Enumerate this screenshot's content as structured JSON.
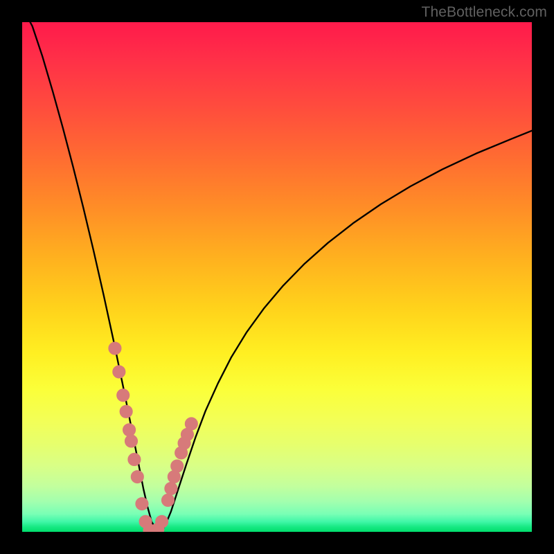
{
  "watermark": "TheBottleneck.com",
  "colors": {
    "background_frame": "#000000",
    "curve_stroke": "#000000",
    "marker_fill": "#d77a7a",
    "marker_stroke": "#d77a7a"
  },
  "chart_data": {
    "type": "line",
    "title": "",
    "xlabel": "",
    "ylabel": "",
    "xlim": [
      0,
      100
    ],
    "ylim": [
      0,
      100
    ],
    "grid": false,
    "legend": false,
    "series": [
      {
        "name": "bottleneck-curve",
        "x": [
          0,
          2,
          4,
          6,
          8,
          10,
          12,
          14,
          16,
          18,
          20,
          22,
          23,
          23.8,
          24.6,
          25.4,
          26.2,
          27,
          28,
          29.2,
          30.6,
          32.2,
          34,
          36,
          38.4,
          41,
          44,
          47.4,
          51.2,
          55.4,
          60,
          65,
          70.4,
          76.2,
          82.4,
          89,
          96,
          100
        ],
        "y": [
          103,
          99.2,
          93.2,
          86.4,
          79.2,
          71.6,
          63.6,
          55.2,
          46.4,
          37.2,
          27.6,
          17.6,
          12.5,
          8.4,
          4.9,
          2.0,
          0.6,
          0.0,
          1.1,
          4.0,
          8.3,
          13.2,
          18.5,
          23.8,
          29.1,
          34.2,
          39.1,
          43.8,
          48.3,
          52.6,
          56.7,
          60.6,
          64.3,
          67.8,
          71.1,
          74.2,
          77.1,
          78.7
        ]
      }
    ],
    "markers": {
      "name": "sample-points",
      "x": [
        18.2,
        19.0,
        19.8,
        20.4,
        21.0,
        21.4,
        22.0,
        22.6,
        23.5,
        24.2,
        25.0,
        25.8,
        26.6,
        27.4,
        28.6,
        29.2,
        29.8,
        30.4,
        31.2,
        31.8,
        32.4,
        33.2
      ],
      "y": [
        36.0,
        31.4,
        26.8,
        23.6,
        20.0,
        17.8,
        14.2,
        10.8,
        5.5,
        2.0,
        0.3,
        0.1,
        0.5,
        2.0,
        6.2,
        8.5,
        10.8,
        12.9,
        15.5,
        17.4,
        19.1,
        21.2
      ]
    }
  }
}
